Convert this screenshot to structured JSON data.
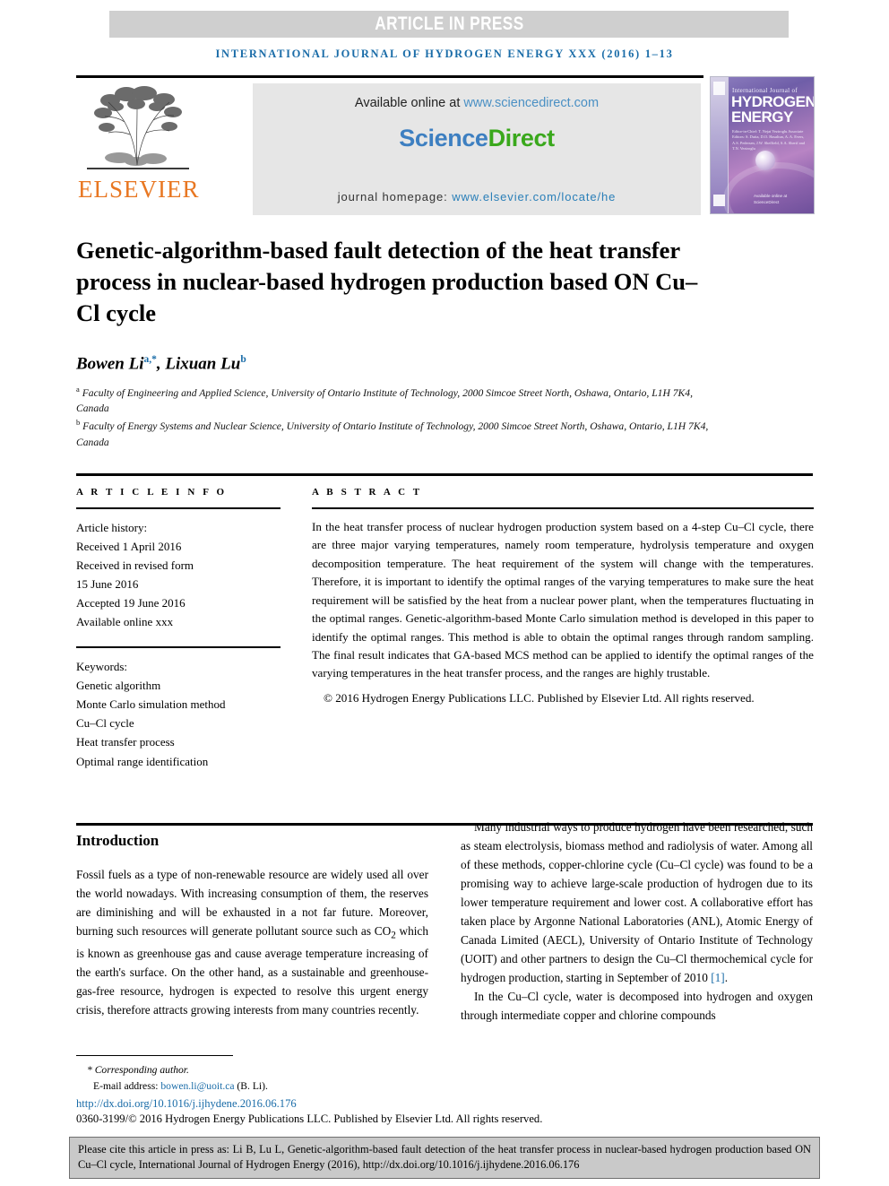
{
  "banner": {
    "article_in_press": "ARTICLE IN PRESS"
  },
  "running_head": "INTERNATIONAL JOURNAL OF HYDROGEN ENERGY XXX (2016) 1–13",
  "masthead": {
    "publisher_name": "ELSEVIER",
    "available_online_label": "Available online at",
    "sciencedirect_url": "www.sciencedirect.com",
    "sciencedirect_logo_part1": "Science",
    "sciencedirect_logo_part2": "Direct",
    "journal_homepage_label": "journal homepage:",
    "journal_homepage_url": "www.elsevier.com/locate/he",
    "cover": {
      "line_top": "International Journal of",
      "line_hydrogen": "HYDROGEN",
      "line_energy": "ENERGY",
      "editors": "Editor-in-Chief: T. Nejat Veziroglu   Associate Editors: S. Dutta, D.O. Hasaltun, A. A. Evers, A.S. Pedersen, J.W. Sheffield, S.A. Sherif and T.N. Veziroglu",
      "sciencedirect_mark": "Available online at ScienceDirect"
    }
  },
  "article": {
    "title": "Genetic-algorithm-based fault detection of the heat transfer process in nuclear-based hydrogen production based ON Cu–Cl cycle",
    "authors": [
      {
        "name": "Bowen Li",
        "marks": "a,*"
      },
      {
        "name": "Lixuan Lu",
        "marks": "b"
      }
    ],
    "affiliations": [
      {
        "mark": "a",
        "text": "Faculty of Engineering and Applied Science, University of Ontario Institute of Technology, 2000 Simcoe Street North, Oshawa, Ontario, L1H 7K4, Canada"
      },
      {
        "mark": "b",
        "text": "Faculty of Energy Systems and Nuclear Science, University of Ontario Institute of Technology, 2000 Simcoe Street North, Oshawa, Ontario, L1H 7K4, Canada"
      }
    ]
  },
  "article_info": {
    "heading": "A R T I C L E   I N F O",
    "history_label": "Article history:",
    "history": [
      "Received 1 April 2016",
      "Received in revised form",
      "15 June 2016",
      "Accepted 19 June 2016",
      "Available online xxx"
    ],
    "keywords_label": "Keywords:",
    "keywords": [
      "Genetic algorithm",
      "Monte Carlo simulation method",
      "Cu–Cl cycle",
      "Heat transfer process",
      "Optimal range identification"
    ]
  },
  "abstract": {
    "heading": "A B S T R A C T",
    "text": "In the heat transfer process of nuclear hydrogen production system based on a 4-step Cu–Cl cycle, there are three major varying temperatures, namely room temperature, hydrolysis temperature and oxygen decomposition temperature. The heat requirement of the system will change with the temperatures. Therefore, it is important to identify the optimal ranges of the varying temperatures to make sure the heat requirement will be satisfied by the heat from a nuclear power plant, when the temperatures fluctuating in the optimal ranges. Genetic-algorithm-based Monte Carlo simulation method is developed in this paper to identify the optimal ranges. This method is able to obtain the optimal ranges through random sampling. The final result indicates that GA-based MCS method can be applied to identify the optimal ranges of the varying temperatures in the heat transfer process, and the ranges are highly trustable.",
    "copyright": "© 2016 Hydrogen Energy Publications LLC. Published by Elsevier Ltd. All rights reserved."
  },
  "body": {
    "section_heading": "Introduction",
    "left_paragraphs": [
      "Fossil fuels as a type of non-renewable resource are widely used all over the world nowadays. With increasing consumption of them, the reserves are diminishing and will be exhausted in a not far future. Moreover, burning such resources will generate pollutant source such as CO2 which is known as greenhouse gas and cause average temperature increasing of the earth's surface. On the other hand, as a sustainable and greenhouse-gas-free resource, hydrogen is expected to resolve this urgent energy crisis, therefore attracts growing interests from many countries recently."
    ],
    "right_paragraph_1": "Many industrial ways to produce hydrogen have been researched, such as steam electrolysis, biomass method and radiolysis of water. Among all of these methods, copper-chlorine cycle (Cu–Cl cycle) was found to be a promising way to achieve large-scale production of hydrogen due to its lower temperature requirement and lower cost. A collaborative effort has taken place by Argonne National Laboratories (ANL), Atomic Energy of Canada Limited (AECL), University of Ontario Institute of Technology (UOIT) and other partners to design the Cu–Cl thermochemical cycle for hydrogen production, starting in September of 2010 ",
    "right_paragraph_1_ref": "[1]",
    "right_paragraph_1_end": ".",
    "right_paragraph_2": "In the Cu–Cl cycle, water is decomposed into hydrogen and oxygen through intermediate copper and chlorine compounds"
  },
  "footnote": {
    "corresponding": "* Corresponding author.",
    "email_label": "E-mail address:",
    "email": "bowen.li@uoit.ca",
    "email_suffix": "(B. Li).",
    "doi": "http://dx.doi.org/10.1016/j.ijhydene.2016.06.176",
    "issn": "0360-3199/© 2016 Hydrogen Energy Publications LLC. Published by Elsevier Ltd. All rights reserved."
  },
  "citation_box": {
    "text": "Please cite this article in press as: Li B, Lu L, Genetic-algorithm-based fault detection of the heat transfer process in nuclear-based hydrogen production based ON Cu–Cl cycle, International Journal of Hydrogen Energy (2016), http://dx.doi.org/10.1016/j.ijhydene.2016.06.176"
  },
  "colors": {
    "link_blue": "#1a6ca8",
    "elsevier_orange": "#e87722",
    "sciencedirect_green": "#3aa81c",
    "banner_gray": "#cfcfcf",
    "citation_gray": "#c9c9c9"
  }
}
